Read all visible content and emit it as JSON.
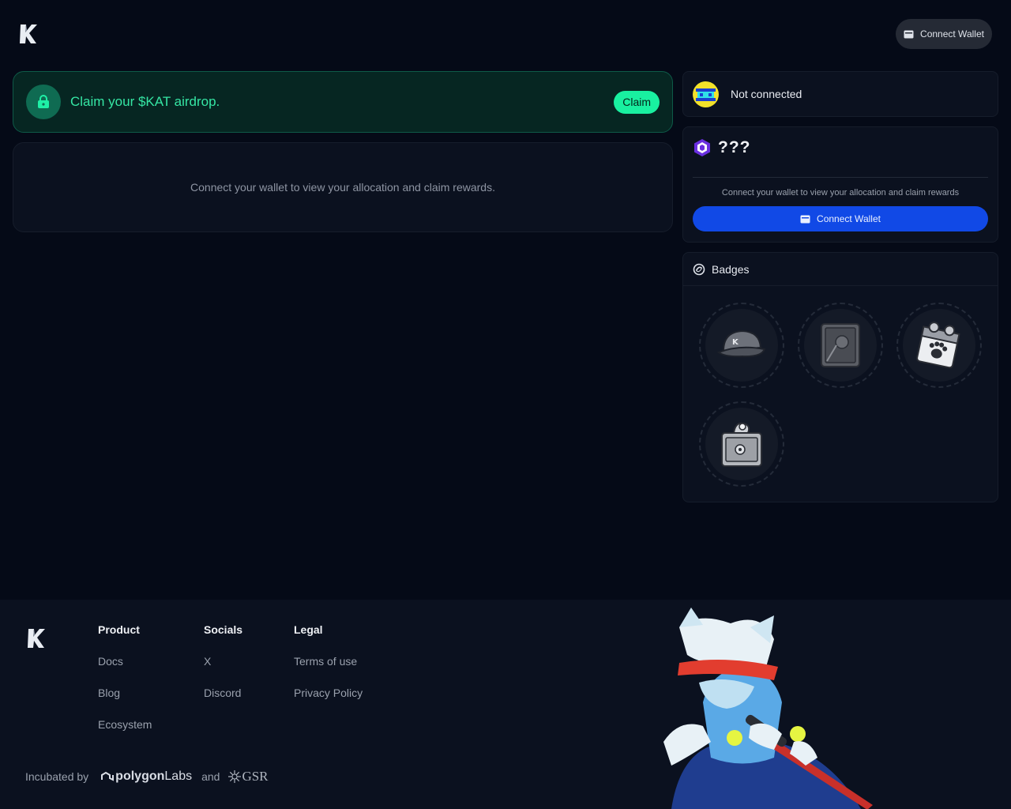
{
  "header": {
    "logo": "kat-logo",
    "connect_label": "Connect Wallet"
  },
  "claim_banner": {
    "text": "Claim your $KAT airdrop.",
    "button_label": "Claim",
    "icon": "lock-icon",
    "accent_color": "#19f0a0"
  },
  "info_card": {
    "message": "Connect your wallet to view your allocation and claim rewards."
  },
  "wallet_status": {
    "text": "Not connected",
    "avatar": "avatar-icon"
  },
  "points": {
    "value": "???",
    "message": "Connect your wallet to view your allocation and claim rewards",
    "connect_label": "Connect Wallet",
    "button_color": "#1149e6"
  },
  "badges": {
    "title": "Badges",
    "items": [
      "cap-badge",
      "vault-badge",
      "calendar-badge",
      "safe-badge"
    ]
  },
  "footer": {
    "columns": [
      {
        "heading": "Product",
        "links": [
          "Docs",
          "Blog",
          "Ecosystem"
        ]
      },
      {
        "heading": "Socials",
        "links": [
          "X",
          "Discord"
        ]
      },
      {
        "heading": "Legal",
        "links": [
          "Terms of use",
          "Privacy Policy"
        ]
      }
    ],
    "incubated_label": "Incubated by",
    "polygon_bold": "polygon",
    "polygon_light": "Labs",
    "and_label": "and",
    "gsr_label": "GSR"
  }
}
